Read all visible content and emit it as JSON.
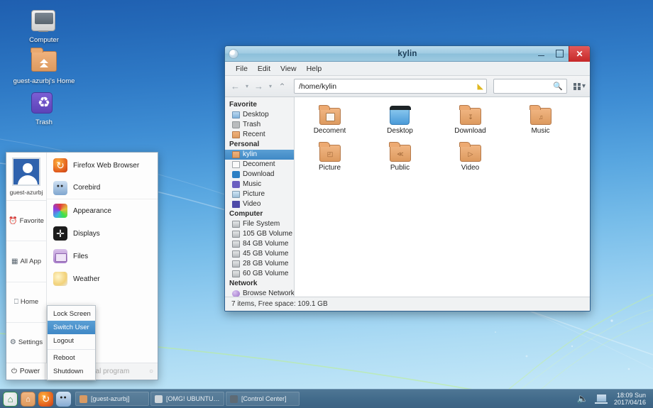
{
  "desktop": {
    "icons": [
      {
        "label": "Computer",
        "icon": "computer-icon"
      },
      {
        "label": "guest-azurbj's Home",
        "icon": "home-folder-icon"
      },
      {
        "label": "Trash",
        "icon": "trash-icon"
      }
    ]
  },
  "file_manager": {
    "title": "kylin",
    "window_buttons": {
      "minimize": "–",
      "maximize": "□",
      "close": "✕"
    },
    "menu": [
      "File",
      "Edit",
      "View",
      "Help"
    ],
    "toolbar": {
      "back": "←",
      "back_caret": "▾",
      "forward": "→",
      "forward_caret": "▾",
      "up": "⌃",
      "path_value": "/home/kylin",
      "path_clear_icon": "clear-icon",
      "search_value": "",
      "search_placeholder": "",
      "search_icon": "search-icon",
      "view_caret": "▾"
    },
    "sidebar": [
      {
        "group": "Favorite",
        "items": [
          {
            "label": "Desktop",
            "icon": "desktop-icon",
            "selected": false
          },
          {
            "label": "Trash",
            "icon": "trash-icon",
            "selected": false
          },
          {
            "label": "Recent",
            "icon": "recent-folder-icon",
            "selected": false
          }
        ]
      },
      {
        "group": "Personal",
        "items": [
          {
            "label": "kylin",
            "icon": "home-folder-icon",
            "selected": true
          },
          {
            "label": "Decoment",
            "icon": "document-icon",
            "selected": false
          },
          {
            "label": "Download",
            "icon": "download-icon",
            "selected": false
          },
          {
            "label": "Music",
            "icon": "music-icon",
            "selected": false
          },
          {
            "label": "Picture",
            "icon": "picture-icon",
            "selected": false
          },
          {
            "label": "Video",
            "icon": "video-icon",
            "selected": false
          }
        ]
      },
      {
        "group": "Computer",
        "items": [
          {
            "label": "File System",
            "icon": "drive-icon",
            "selected": false
          },
          {
            "label": "105 GB Volume",
            "icon": "drive-icon",
            "selected": false
          },
          {
            "label": "84 GB Volume",
            "icon": "drive-icon",
            "selected": false
          },
          {
            "label": "45 GB Volume",
            "icon": "drive-icon",
            "selected": false
          },
          {
            "label": "28 GB Volume",
            "icon": "drive-icon",
            "selected": false
          },
          {
            "label": "60 GB Volume",
            "icon": "drive-icon",
            "selected": false
          }
        ]
      },
      {
        "group": "Network",
        "items": [
          {
            "label": "Browse Network",
            "icon": "network-icon",
            "selected": false
          }
        ]
      }
    ],
    "files": [
      {
        "label": "Decoment",
        "icon": "folder-document-icon",
        "emblem": "□"
      },
      {
        "label": "Desktop",
        "icon": "desktop-folder-icon",
        "emblem": ""
      },
      {
        "label": "Download",
        "icon": "folder-download-icon",
        "emblem": "↧"
      },
      {
        "label": "Music",
        "icon": "folder-music-icon",
        "emblem": "♫"
      },
      {
        "label": "Picture",
        "icon": "folder-picture-icon",
        "emblem": "◰"
      },
      {
        "label": "Public",
        "icon": "folder-public-icon",
        "emblem": "≪"
      },
      {
        "label": "Video",
        "icon": "folder-video-icon",
        "emblem": "▷"
      }
    ],
    "status": "7 items, Free space: 109.1 GB"
  },
  "start_menu": {
    "username": "guest-azurbj",
    "tabs": [
      {
        "label": "Favorite",
        "icon": "clock-icon"
      },
      {
        "label": "All App",
        "icon": "grid-icon"
      },
      {
        "label": "Home",
        "icon": "monitor-icon"
      },
      {
        "label": "Settings",
        "icon": "gear-icon"
      }
    ],
    "apps": [
      {
        "label": "Firefox Web Browser",
        "icon": "firefox-icon"
      },
      {
        "label": "Corebird",
        "icon": "corebird-icon"
      },
      {
        "label": "Appearance",
        "icon": "appearance-icon"
      },
      {
        "label": "Displays",
        "icon": "displays-icon"
      },
      {
        "label": "Files",
        "icon": "files-icon"
      },
      {
        "label": "Weather",
        "icon": "weather-icon"
      }
    ],
    "power_label": "Power",
    "power_icon": "power-icon",
    "power_more": "›",
    "search_placeholder": "Search local program",
    "search_icon": "search-icon",
    "power_menu": [
      {
        "label": "Lock Screen",
        "selected": false
      },
      {
        "label": "Switch User",
        "selected": true
      },
      {
        "label": "Logout",
        "selected": false
      },
      {
        "label": "Reboot",
        "selected": false
      },
      {
        "label": "Shutdown",
        "selected": false
      }
    ]
  },
  "taskbar": {
    "launchers": [
      {
        "name": "start-button",
        "icon": "start-home-icon"
      },
      {
        "name": "files-launcher",
        "icon": "folder-icon"
      },
      {
        "name": "firefox-launcher",
        "icon": "firefox-icon"
      },
      {
        "name": "corebird-launcher",
        "icon": "corebird-icon"
      }
    ],
    "tasks": [
      {
        "label": "[guest-azurbj]",
        "icon": "folder-icon"
      },
      {
        "label": "[OMG! UBUNTU! (@om…",
        "icon": "firefox-icon"
      },
      {
        "label": "[Control Center]",
        "icon": "settings-icon"
      }
    ],
    "tray": {
      "volume_icon": "volume-icon",
      "network_icon": "network-icon"
    },
    "clock_time": "18:09 Sun",
    "clock_date": "2017/04/16"
  },
  "colors": {
    "accent_blue": "#4089c6",
    "titlebar": "#9fcbe2",
    "close_red": "#c62828",
    "taskbar": "#416a8a",
    "folder_orange": "#dd9a5f"
  }
}
